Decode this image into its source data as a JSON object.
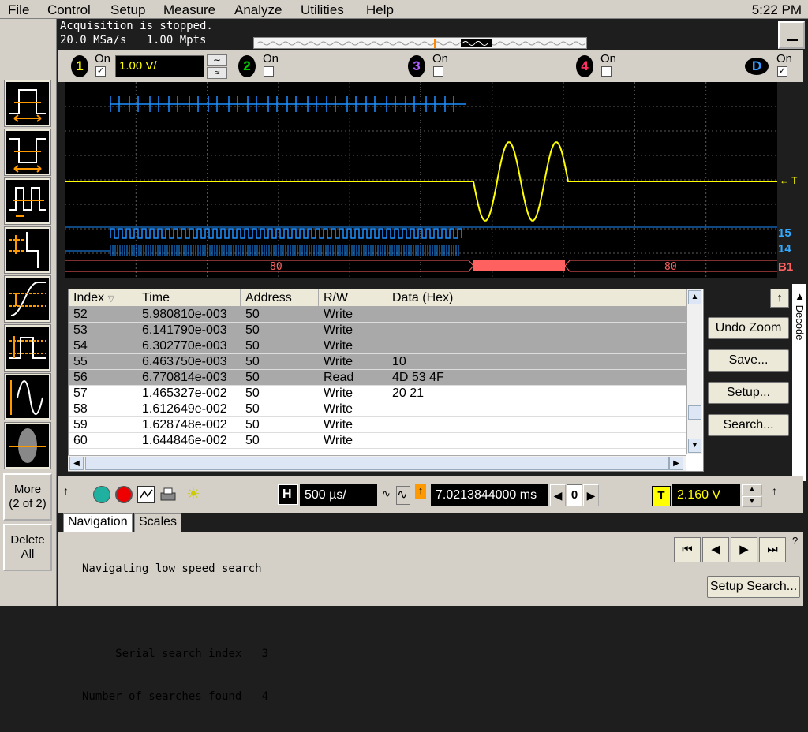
{
  "menu": {
    "items": [
      "File",
      "Control",
      "Setup",
      "Measure",
      "Analyze",
      "Utilities",
      "Help"
    ],
    "clock": "5:22 PM"
  },
  "acquisition": {
    "status": "Acquisition is stopped.",
    "rate": "20.0 MSa/s   1.00 Mpts"
  },
  "channels": {
    "ch1": {
      "num": "1",
      "on_label": "On",
      "checked": true,
      "scale": "1.00 V/",
      "color": "#ffff00"
    },
    "ch2": {
      "num": "2",
      "on_label": "On",
      "checked": false,
      "color": "#00c000"
    },
    "ch3": {
      "num": "3",
      "on_label": "On",
      "checked": false,
      "color": "#a040ff"
    },
    "ch4": {
      "num": "4",
      "on_label": "On",
      "checked": false,
      "color": "#ff3060"
    },
    "digital": {
      "num": "D",
      "on_label": "On",
      "checked": true,
      "color": "#3399ff"
    }
  },
  "waveform": {
    "trigger_marker": "T",
    "label_15": "15",
    "label_14": "14",
    "bus_label": "B1",
    "bus_value_left": "80",
    "bus_value_right": "80",
    "colors": {
      "analog": "#ffff00",
      "digital": "#1e90ff",
      "bus": "#ff6060",
      "grid": "#5a5a5a"
    }
  },
  "leftbar": {
    "more_label_1": "More",
    "more_label_2": "(2 of 2)",
    "delete_label_1": "Delete",
    "delete_label_2": "All",
    "tool_icons": [
      "pulse-width-positive-icon",
      "pulse-width-negative-icon",
      "pattern-width-icon",
      "setup-hold-icon",
      "transition-icon",
      "runt-icon",
      "edge-then-edge-icon",
      "zone-icon"
    ]
  },
  "table": {
    "headers": [
      "Index",
      "Time",
      "Address",
      "R/W",
      "Data (Hex)"
    ],
    "rows": [
      {
        "index": "52",
        "time": "5.980810e-003",
        "address": "50",
        "rw": "Write",
        "data": "",
        "selected": true
      },
      {
        "index": "53",
        "time": "6.141790e-003",
        "address": "50",
        "rw": "Write",
        "data": "",
        "selected": true
      },
      {
        "index": "54",
        "time": "6.302770e-003",
        "address": "50",
        "rw": "Write",
        "data": "",
        "selected": true
      },
      {
        "index": "55",
        "time": "6.463750e-003",
        "address": "50",
        "rw": "Write",
        "data": "10",
        "selected": true
      },
      {
        "index": "56",
        "time": "6.770814e-003",
        "address": "50",
        "rw": "Read",
        "data": "4D 53 4F",
        "selected": true
      },
      {
        "index": "57",
        "time": "1.465327e-002",
        "address": "50",
        "rw": "Write",
        "data": "20 21",
        "selected": false
      },
      {
        "index": "58",
        "time": "1.612649e-002",
        "address": "50",
        "rw": "Write",
        "data": "",
        "selected": false
      },
      {
        "index": "59",
        "time": "1.628748e-002",
        "address": "50",
        "rw": "Write",
        "data": "",
        "selected": false
      },
      {
        "index": "60",
        "time": "1.644846e-002",
        "address": "50",
        "rw": "Write",
        "data": "",
        "selected": false
      }
    ]
  },
  "panel": {
    "undo_zoom": "Undo Zoom",
    "save": "Save...",
    "setup": "Setup...",
    "search": "Search...",
    "decode_tab": "Decode"
  },
  "controls": {
    "horiz_label": "H",
    "timebase": "500 µs/",
    "delay": "7.0213844000 ms",
    "delay_ref": "0",
    "trigger_label": "T",
    "trigger_level": "2.160 V"
  },
  "tabs": {
    "navigation": "Navigation",
    "scales": "Scales"
  },
  "nav": {
    "line1": "Navigating low speed search",
    "index_label": "Serial search index",
    "index_value": "3",
    "found_label": "Number of searches found",
    "found_value": "4",
    "setup_search": "Setup Search..."
  }
}
